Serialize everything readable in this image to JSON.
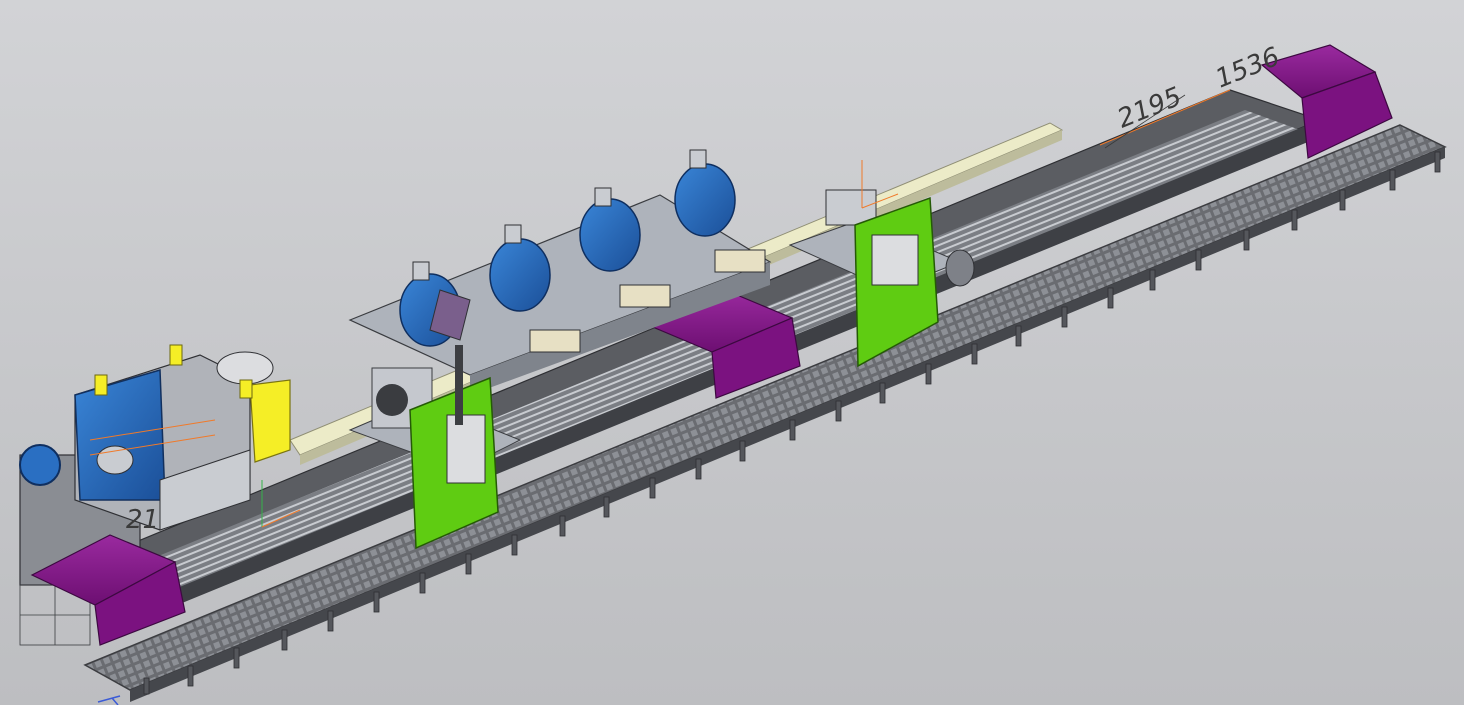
{
  "viewport": {
    "background": "#c9cacd"
  },
  "dimensions": {
    "dim_a": "2195",
    "dim_b": "1536",
    "dim_c": "21"
  },
  "colors": {
    "purple_cover": "#7b1280",
    "green_guard": "#5fcc12",
    "blue_chuck": "#2a6fc2",
    "yellow_plate": "#f5ee26",
    "rail_cream": "#ecebc8",
    "bed_grey": "#5b5d62",
    "carriage_grey": "#aeb3bb",
    "dimension_orange": "#f07a2a"
  },
  "icons": {
    "axis_triad": "axis-triad-icon",
    "view_cube": "orientation-icon"
  }
}
